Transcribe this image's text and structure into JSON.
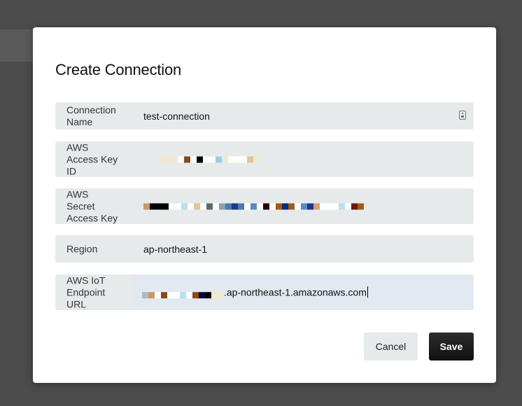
{
  "dialog": {
    "title": "Create Connection",
    "fields": [
      {
        "label": "Connection\nName",
        "value": "test-connection"
      },
      {
        "label": "AWS\nAccess Key\nID",
        "value": ""
      },
      {
        "label": "AWS\nSecret\nAccess Key",
        "value": ""
      },
      {
        "label": "Region",
        "value": "ap-northeast-1"
      },
      {
        "label": "AWS IoT\nEndpoint\nURL",
        "value_suffix": ".ap-northeast-1.amazonaws.com"
      }
    ],
    "buttons": {
      "cancel": "Cancel",
      "save": "Save"
    }
  },
  "masked_colors": {
    "access_key": [
      "#f0e8cf",
      "#f0e8cf",
      "#f0e8cf",
      "#ffffff",
      "#8a4a18",
      "#ffffff",
      "#000000",
      "#ffffff",
      "#ffffff",
      "#9ccbe8",
      "#f0e8cf",
      "#ffffff",
      "#ffffff",
      "#ffffff",
      "#e0c49a",
      "#f0e8cf"
    ],
    "secret_key": [
      "#c49a6a",
      "#000000",
      "#000000",
      "#000000",
      "#ffffff",
      "#ffffff",
      "#b8e0ee",
      "#ffffff",
      "#e0c49a",
      "#ffffff",
      "#5a6a6a",
      "#ffffff",
      "#8aa0b4",
      "#4a7ab0",
      "#1a3a8a",
      "#4a7ab0",
      "#ffffff",
      "#5a8ac0",
      "#ffffff",
      "#2a0000",
      "#ffffff",
      "#a05a18",
      "#0a2a7a",
      "#a05a18",
      "#ffffff",
      "#5a8ac0",
      "#1a3a8a",
      "#d4a070",
      "#ffffff",
      "#ffffff",
      "#ffffff",
      "#b8e0ee",
      "#ffffff",
      "#6a1a00",
      "#a05a18"
    ],
    "endpoint": [
      "#b0b8c8",
      "#c49a6a",
      "#ffffff",
      "#8a4a18",
      "#ffffff",
      "#ffffff",
      "#b8e0ee",
      "#ffffff",
      "#8a4a18",
      "#000a3a",
      "#000000",
      "#f0e8cf",
      "#f0e8cf"
    ]
  }
}
